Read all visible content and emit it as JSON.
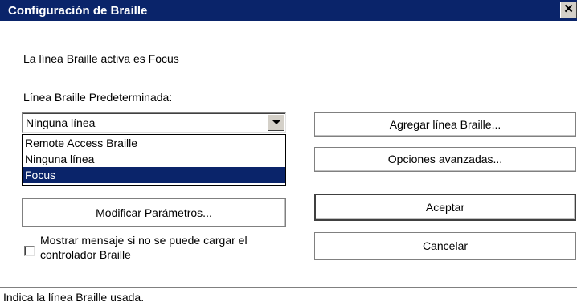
{
  "window": {
    "title": "Configuración de Braille",
    "close_glyph": "✕"
  },
  "info": {
    "active_line": "La línea Braille activa es Focus",
    "default_label": "Línea Braille Predeterminada:"
  },
  "combo": {
    "value": "Ninguna línea",
    "options": [
      "Remote Access Braille",
      "Ninguna línea",
      "Focus"
    ],
    "highlighted": "Focus"
  },
  "buttons": {
    "add_line": "Agregar línea Braille...",
    "advanced": "Opciones avanzadas...",
    "modify": "Modificar Parámetros...",
    "accept": "Aceptar",
    "cancel": "Cancelar"
  },
  "checkbox": {
    "label": "Mostrar mensaje si no se puede cargar el controlador Braille",
    "checked": false
  },
  "status": {
    "text": "Indica la línea Braille usada."
  },
  "colors": {
    "titlebar": "#0a246a",
    "selection": "#0a246a"
  }
}
